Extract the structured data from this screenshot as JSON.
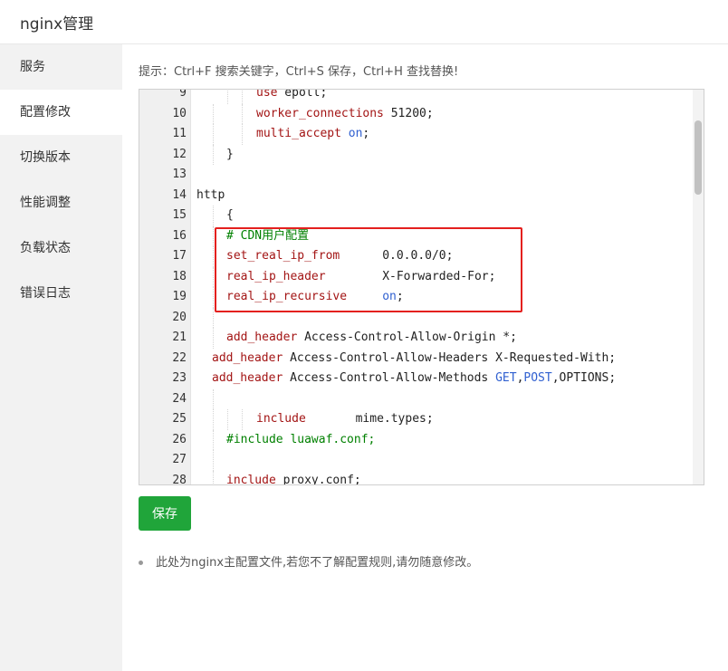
{
  "window": {
    "title": "nginx管理"
  },
  "sidebar": {
    "items": [
      {
        "label": "服务",
        "active": false
      },
      {
        "label": "配置修改",
        "active": true
      },
      {
        "label": "切换版本",
        "active": false
      },
      {
        "label": "性能调整",
        "active": false
      },
      {
        "label": "负载状态",
        "active": false
      },
      {
        "label": "错误日志",
        "active": false
      }
    ]
  },
  "hint": "提示：Ctrl+F 搜索关键字，Ctrl+S 保存，Ctrl+H 查找替换!",
  "editor": {
    "lines": [
      {
        "n": "9",
        "indent": 66,
        "guides": [
          34,
          50
        ],
        "tokens": [
          [
            "kw",
            "use"
          ],
          [
            "pl",
            " epoll;"
          ]
        ]
      },
      {
        "n": "10",
        "indent": 66,
        "guides": [
          18,
          50
        ],
        "tokens": [
          [
            "kw",
            "worker_connections"
          ],
          [
            "pl",
            " 51200;"
          ]
        ]
      },
      {
        "n": "11",
        "indent": 66,
        "guides": [
          18,
          50
        ],
        "tokens": [
          [
            "kw",
            "multi_accept"
          ],
          [
            "pl",
            " "
          ],
          [
            "on",
            "on"
          ],
          [
            "pl",
            ";"
          ]
        ]
      },
      {
        "n": "12",
        "indent": 33,
        "guides": [
          18
        ],
        "tokens": [
          [
            "pl",
            "}"
          ]
        ]
      },
      {
        "n": "13",
        "indent": 0,
        "guides": [],
        "tokens": []
      },
      {
        "n": "14",
        "indent": 0,
        "guides": [],
        "tokens": [
          [
            "pl",
            "http"
          ]
        ]
      },
      {
        "n": "15",
        "indent": 33,
        "guides": [
          18
        ],
        "tokens": [
          [
            "pl",
            "{"
          ]
        ]
      },
      {
        "n": "16",
        "indent": 33,
        "guides": [
          18
        ],
        "tokens": [
          [
            "cm",
            "# CDN用户配置"
          ]
        ]
      },
      {
        "n": "17",
        "indent": 33,
        "guides": [
          18
        ],
        "tokens": [
          [
            "kw",
            "set_real_ip_from"
          ],
          [
            "pl",
            "      0.0.0.0/0;"
          ]
        ]
      },
      {
        "n": "18",
        "indent": 33,
        "guides": [
          18
        ],
        "tokens": [
          [
            "kw",
            "real_ip_header"
          ],
          [
            "pl",
            "        X-Forwarded-For;"
          ]
        ]
      },
      {
        "n": "19",
        "indent": 33,
        "guides": [
          18
        ],
        "tokens": [
          [
            "kw",
            "real_ip_recursive"
          ],
          [
            "pl",
            "     "
          ],
          [
            "on",
            "on"
          ],
          [
            "pl",
            ";"
          ]
        ]
      },
      {
        "n": "20",
        "indent": 0,
        "guides": [
          18
        ],
        "tokens": []
      },
      {
        "n": "21",
        "indent": 33,
        "guides": [
          18
        ],
        "tokens": [
          [
            "kw",
            "add_header"
          ],
          [
            "pl",
            " Access-Control-Allow-Origin *;"
          ]
        ]
      },
      {
        "n": "22",
        "indent": 17,
        "guides": [],
        "tokens": [
          [
            "kw",
            "add_header"
          ],
          [
            "pl",
            " Access-Control-Allow-Headers X-Requested-With;"
          ]
        ]
      },
      {
        "n": "23",
        "indent": 17,
        "guides": [],
        "tokens": [
          [
            "kw",
            "add_header"
          ],
          [
            "pl",
            " Access-Control-Allow-Methods "
          ],
          [
            "on",
            "GET"
          ],
          [
            "pl",
            ","
          ],
          [
            "on",
            "POST"
          ],
          [
            "pl",
            ",OPTIONS;"
          ]
        ]
      },
      {
        "n": "24",
        "indent": 0,
        "guides": [
          18
        ],
        "tokens": []
      },
      {
        "n": "25",
        "indent": 66,
        "guides": [
          18,
          34,
          50
        ],
        "tokens": [
          [
            "kw",
            "include"
          ],
          [
            "pl",
            "       mime.types;"
          ]
        ]
      },
      {
        "n": "26",
        "indent": 33,
        "guides": [
          18
        ],
        "tokens": [
          [
            "cm",
            "#include luawaf.conf;"
          ]
        ]
      },
      {
        "n": "27",
        "indent": 0,
        "guides": [
          18
        ],
        "tokens": []
      },
      {
        "n": "28",
        "indent": 33,
        "guides": [
          18
        ],
        "tokens": [
          [
            "kw",
            "include"
          ],
          [
            "pl",
            " proxy.conf;"
          ]
        ]
      }
    ]
  },
  "save_label": "保存",
  "note": "此处为nginx主配置文件,若您不了解配置规则,请勿随意修改。",
  "colors": {
    "accent": "#20a53a",
    "highlight_box": "#e4201e"
  }
}
